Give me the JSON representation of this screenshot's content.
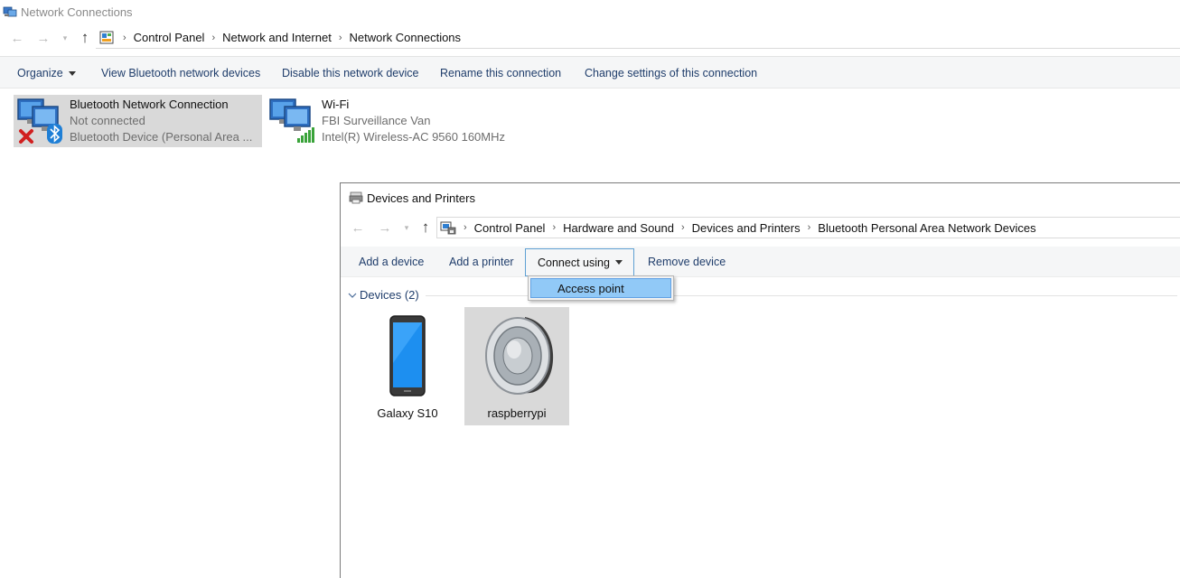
{
  "network_connections": {
    "title": "Network Connections",
    "breadcrumb": [
      "Control Panel",
      "Network and Internet",
      "Network Connections"
    ],
    "toolbar": {
      "organize": "Organize",
      "view_bluetooth": "View Bluetooth network devices",
      "disable": "Disable this network device",
      "rename": "Rename this connection",
      "change_settings": "Change settings of this connection"
    },
    "connections": [
      {
        "name": "Bluetooth Network Connection",
        "status": "Not connected",
        "device": "Bluetooth Device (Personal Area ..."
      },
      {
        "name": "Wi-Fi",
        "status": "FBI Surveillance Van",
        "device": "Intel(R) Wireless-AC 9560 160MHz"
      }
    ]
  },
  "devices_printers": {
    "title": "Devices and Printers",
    "breadcrumb": [
      "Control Panel",
      "Hardware and Sound",
      "Devices and Printers",
      "Bluetooth Personal Area Network Devices"
    ],
    "toolbar": {
      "add_device": "Add a device",
      "add_printer": "Add a printer",
      "connect_using": "Connect using",
      "remove_device": "Remove device"
    },
    "dropdown": {
      "items": [
        "Access point"
      ]
    },
    "group": {
      "label": "Devices (2)"
    },
    "devices": [
      {
        "name": "Galaxy S10",
        "icon": "phone-icon"
      },
      {
        "name": "raspberrypi",
        "icon": "speaker-icon"
      }
    ]
  },
  "colors": {
    "link_text": "#1f3d6b",
    "selection": "#d9d9d9",
    "menu_highlight": "#91c9f7",
    "toolbar_bg": "#f5f6f7"
  }
}
